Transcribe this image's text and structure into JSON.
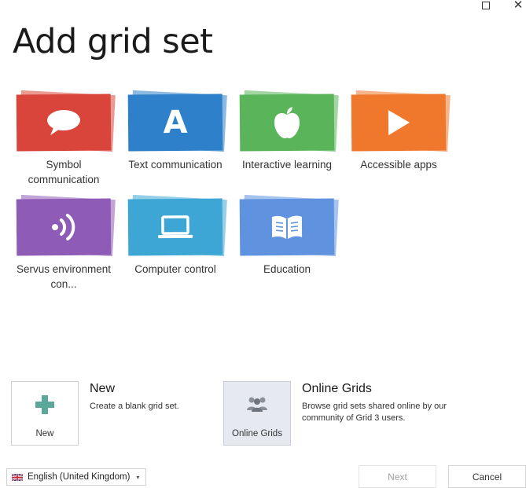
{
  "window": {
    "maximize_label": "",
    "close_label": "✕"
  },
  "page": {
    "title": "Add grid set"
  },
  "tiles": [
    {
      "label": "Symbol communication",
      "color": "#d9453b",
      "icon": "speech-bubble-icon"
    },
    {
      "label": "Text communication",
      "color": "#2d80c9",
      "icon": "letter-a-icon",
      "glyph": "A"
    },
    {
      "label": "Interactive learning",
      "color": "#5ab55a",
      "icon": "apple-icon"
    },
    {
      "label": "Accessible apps",
      "color": "#f0782d",
      "icon": "play-icon"
    },
    {
      "label": "Servus environment con...",
      "color": "#8e5bb7",
      "icon": "signal-waves-icon"
    },
    {
      "label": "Computer control",
      "color": "#3ea6d4",
      "icon": "laptop-icon"
    },
    {
      "label": "Education",
      "color": "#5f93e0",
      "icon": "open-book-icon"
    }
  ],
  "new_option": {
    "button_caption": "New",
    "title": "New",
    "description": "Create a blank grid set.",
    "icon": "plus-icon",
    "icon_color": "#5aa89a"
  },
  "online_option": {
    "button_caption": "Online Grids",
    "title": "Online Grids",
    "description": "Browse grid sets shared online by our community of Grid 3 users.",
    "icon": "people-icon"
  },
  "language": {
    "selected": "English (United Kingdom)",
    "icon": "uk-flag-icon"
  },
  "footer": {
    "next_label": "Next",
    "cancel_label": "Cancel"
  }
}
